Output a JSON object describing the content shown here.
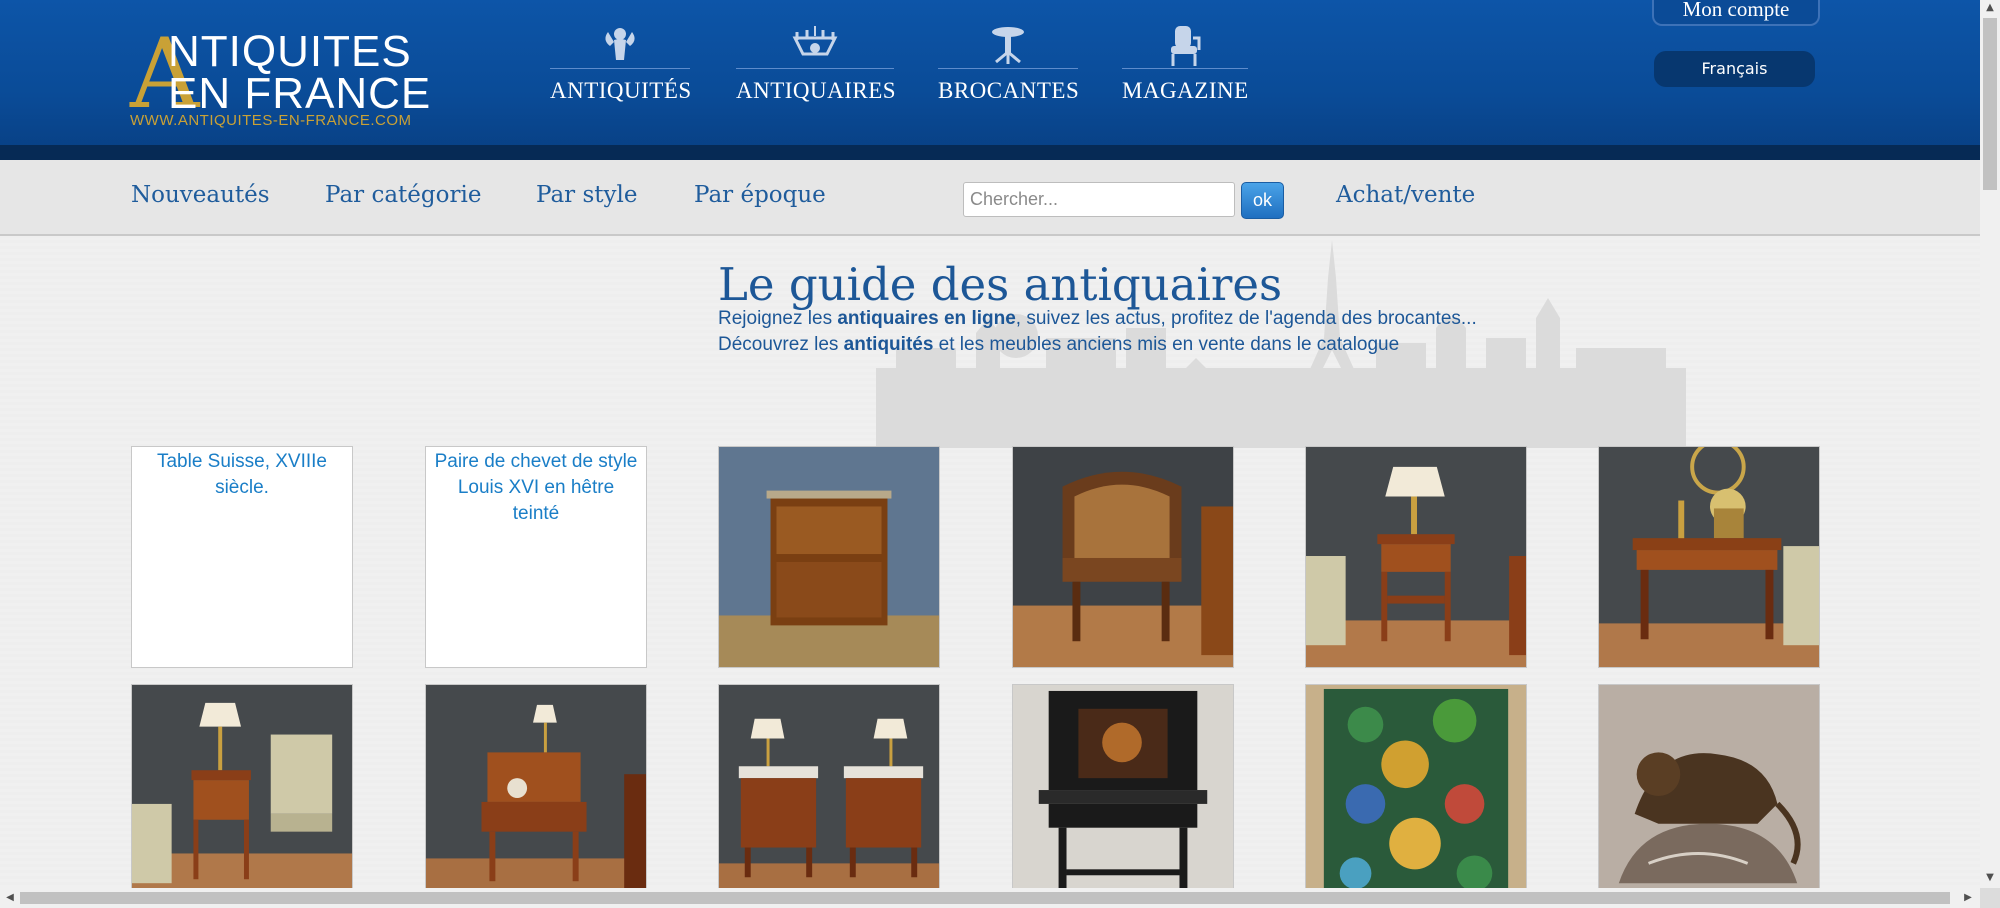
{
  "header": {
    "logo": {
      "big_letter": "A",
      "line1": "NTIQUITES",
      "line2": "EN FRANCE",
      "url": "WWW.ANTIQUITES-EN-FRANCE.COM"
    },
    "nav": [
      {
        "label": "ANTIQUITÉS",
        "icon": "cherub-icon"
      },
      {
        "label": "ANTIQUAIRES",
        "icon": "chandelier-icon"
      },
      {
        "label": "BROCANTES",
        "icon": "pedestal-table-icon"
      },
      {
        "label": "MAGAZINE",
        "icon": "armchair-icon"
      }
    ],
    "account_label": "Mon compte",
    "language_label": "Français"
  },
  "subnav": {
    "links": [
      "Nouveautés",
      "Par catégorie",
      "Par style",
      "Par époque"
    ],
    "search": {
      "placeholder": "Chercher...",
      "value": ""
    },
    "search_button": "ok",
    "achat_vente": "Achat/vente"
  },
  "guide": {
    "title": "Le guide des antiquaires",
    "line1": {
      "pre": "Rejoignez les ",
      "bold": "antiquaires en ligne",
      "post": ", suivez les actus, profitez de l'agenda des brocantes..."
    },
    "line2": {
      "pre": "Découvrez les ",
      "bold": "antiquités",
      "post": " et les meubles anciens mis en vente dans le catalogue"
    }
  },
  "products": [
    {
      "alt": "Table Suisse, XVIIIe siècle.",
      "broken": true,
      "kind": "none"
    },
    {
      "alt": "Paire de chevet de style Louis XVI en hêtre teinté",
      "broken": true,
      "kind": "none"
    },
    {
      "alt": "",
      "broken": false,
      "kind": "secretaire"
    },
    {
      "alt": "",
      "broken": false,
      "kind": "cane-armchair"
    },
    {
      "alt": "",
      "broken": false,
      "kind": "nightstand-lamp"
    },
    {
      "alt": "",
      "broken": false,
      "kind": "side-table-flowers"
    },
    {
      "alt": "",
      "broken": false,
      "kind": "nightstand-lamp-chair"
    },
    {
      "alt": "",
      "broken": false,
      "kind": "small-desk"
    },
    {
      "alt": "",
      "broken": false,
      "kind": "pair-nightstands"
    },
    {
      "alt": "",
      "broken": false,
      "kind": "black-cabinet"
    },
    {
      "alt": "",
      "broken": false,
      "kind": "painting"
    },
    {
      "alt": "",
      "broken": false,
      "kind": "bronze-panther"
    }
  ],
  "colors": {
    "header_blue": "#0b4e9c",
    "header_dark": "#062a55",
    "logo_gold": "#c9a136",
    "link_blue": "#1f5c9c",
    "button_blue": "#2a80d0"
  }
}
